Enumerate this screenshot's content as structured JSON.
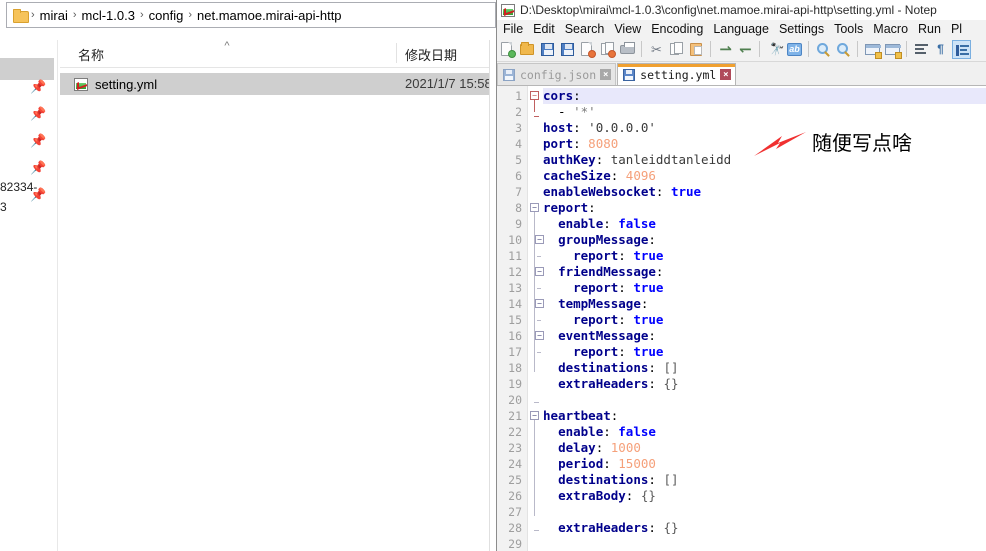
{
  "explorer": {
    "breadcrumb": {
      "folder_icon": "folder-icon",
      "items": [
        "mirai",
        "mcl-1.0.3",
        "config",
        "net.mamoe.mirai-api-http"
      ],
      "separator": "›"
    },
    "columns": {
      "name": "名称",
      "date_modified": "修改日期",
      "sort_caret": "^"
    },
    "files": [
      {
        "icon": "yml-file-icon",
        "name": "setting.yml",
        "date_modified": "2021/1/7 15:58"
      }
    ],
    "sidebar_fragments": {
      "pin_icon": "pin-icon",
      "pin_count": 5,
      "text_fragment_1": "82334-",
      "text_fragment_2": "3"
    }
  },
  "notepad": {
    "title": "D:\\Desktop\\mirai\\mcl-1.0.3\\config\\net.mamoe.mirai-api-http\\setting.yml - Notep",
    "title_icon": "npp-document-icon",
    "menu": [
      "File",
      "Edit",
      "Search",
      "View",
      "Encoding",
      "Language",
      "Settings",
      "Tools",
      "Macro",
      "Run",
      "Pl"
    ],
    "toolbar": [
      "new-file-icon",
      "open-file-icon",
      "save-icon",
      "save-all-icon",
      "close-file-icon",
      "close-all-icon",
      "print-icon",
      "sep",
      "cut-icon",
      "copy-icon",
      "paste-icon",
      "sep",
      "undo-icon",
      "redo-icon",
      "sep",
      "find-icon",
      "replace-icon",
      "sep",
      "zoom-in-icon",
      "zoom-out-icon",
      "sep",
      "sync-vertical-icon",
      "sync-horizontal-icon",
      "sep",
      "word-wrap-icon",
      "show-all-chars-icon",
      "indent-guide-icon"
    ],
    "tabs": [
      {
        "label": "config.json",
        "icon": "saved-doc-icon",
        "close": "×",
        "active": false
      },
      {
        "label": "setting.yml",
        "icon": "saved-doc-icon",
        "close": "×",
        "active": true
      }
    ],
    "editor": {
      "lines": [
        {
          "num": "1",
          "text": "cors:",
          "tokens": [
            {
              "t": "cors",
              "c": "k"
            },
            {
              "t": ":",
              "c": "p"
            }
          ]
        },
        {
          "num": "2",
          "text": "  - '*'",
          "tokens": [
            {
              "t": "  - ",
              "c": "p"
            },
            {
              "t": "'*'",
              "c": "s"
            }
          ]
        },
        {
          "num": "3",
          "text": "host: '0.0.0.0'",
          "tokens": [
            {
              "t": "host",
              "c": "k"
            },
            {
              "t": ": ",
              "c": "p"
            },
            {
              "t": "'0.0.0.0'",
              "c": "t"
            }
          ]
        },
        {
          "num": "4",
          "text": "port: 8080",
          "tokens": [
            {
              "t": "port",
              "c": "k"
            },
            {
              "t": ": ",
              "c": "p"
            },
            {
              "t": "8080",
              "c": "n"
            }
          ]
        },
        {
          "num": "5",
          "text": "authKey: tanleiddtanleidd",
          "tokens": [
            {
              "t": "authKey",
              "c": "k"
            },
            {
              "t": ": ",
              "c": "p"
            },
            {
              "t": "tanleiddtanleidd",
              "c": "t"
            }
          ]
        },
        {
          "num": "6",
          "text": "cacheSize: 4096",
          "tokens": [
            {
              "t": "cacheSize",
              "c": "k"
            },
            {
              "t": ": ",
              "c": "p"
            },
            {
              "t": "4096",
              "c": "n"
            }
          ]
        },
        {
          "num": "7",
          "text": "enableWebsocket: true",
          "tokens": [
            {
              "t": "enableWebsocket",
              "c": "k"
            },
            {
              "t": ": ",
              "c": "p"
            },
            {
              "t": "true",
              "c": "b"
            }
          ]
        },
        {
          "num": "8",
          "text": "report:",
          "tokens": [
            {
              "t": "report",
              "c": "k"
            },
            {
              "t": ":",
              "c": "p"
            }
          ]
        },
        {
          "num": "9",
          "text": "  enable: false",
          "tokens": [
            {
              "t": "  ",
              "c": "p"
            },
            {
              "t": "enable",
              "c": "k"
            },
            {
              "t": ": ",
              "c": "p"
            },
            {
              "t": "false",
              "c": "b"
            }
          ]
        },
        {
          "num": "10",
          "text": "  groupMessage:",
          "tokens": [
            {
              "t": "  ",
              "c": "p"
            },
            {
              "t": "groupMessage",
              "c": "k"
            },
            {
              "t": ":",
              "c": "p"
            }
          ]
        },
        {
          "num": "11",
          "text": "    report: true",
          "tokens": [
            {
              "t": "    ",
              "c": "p"
            },
            {
              "t": "report",
              "c": "k"
            },
            {
              "t": ": ",
              "c": "p"
            },
            {
              "t": "true",
              "c": "b"
            }
          ]
        },
        {
          "num": "12",
          "text": "  friendMessage:",
          "tokens": [
            {
              "t": "  ",
              "c": "p"
            },
            {
              "t": "friendMessage",
              "c": "k"
            },
            {
              "t": ":",
              "c": "p"
            }
          ]
        },
        {
          "num": "13",
          "text": "    report: true",
          "tokens": [
            {
              "t": "    ",
              "c": "p"
            },
            {
              "t": "report",
              "c": "k"
            },
            {
              "t": ": ",
              "c": "p"
            },
            {
              "t": "true",
              "c": "b"
            }
          ]
        },
        {
          "num": "14",
          "text": "  tempMessage:",
          "tokens": [
            {
              "t": "  ",
              "c": "p"
            },
            {
              "t": "tempMessage",
              "c": "k"
            },
            {
              "t": ":",
              "c": "p"
            }
          ]
        },
        {
          "num": "15",
          "text": "    report: true",
          "tokens": [
            {
              "t": "    ",
              "c": "p"
            },
            {
              "t": "report",
              "c": "k"
            },
            {
              "t": ": ",
              "c": "p"
            },
            {
              "t": "true",
              "c": "b"
            }
          ]
        },
        {
          "num": "16",
          "text": "  eventMessage:",
          "tokens": [
            {
              "t": "  ",
              "c": "p"
            },
            {
              "t": "eventMessage",
              "c": "k"
            },
            {
              "t": ":",
              "c": "p"
            }
          ]
        },
        {
          "num": "17",
          "text": "    report: true",
          "tokens": [
            {
              "t": "    ",
              "c": "p"
            },
            {
              "t": "report",
              "c": "k"
            },
            {
              "t": ": ",
              "c": "p"
            },
            {
              "t": "true",
              "c": "b"
            }
          ]
        },
        {
          "num": "18",
          "text": "  destinations: []",
          "tokens": [
            {
              "t": "  ",
              "c": "p"
            },
            {
              "t": "destinations",
              "c": "k"
            },
            {
              "t": ": ",
              "c": "p"
            },
            {
              "t": "[]",
              "c": "br"
            }
          ]
        },
        {
          "num": "19",
          "text": "  extraHeaders: {}",
          "tokens": [
            {
              "t": "  ",
              "c": "p"
            },
            {
              "t": "extraHeaders",
              "c": "k"
            },
            {
              "t": ": ",
              "c": "p"
            },
            {
              "t": "{}",
              "c": "br"
            }
          ]
        },
        {
          "num": "20",
          "text": "",
          "tokens": []
        },
        {
          "num": "21",
          "text": "heartbeat:",
          "tokens": [
            {
              "t": "heartbeat",
              "c": "k"
            },
            {
              "t": ":",
              "c": "p"
            }
          ]
        },
        {
          "num": "22",
          "text": "  enable: false",
          "tokens": [
            {
              "t": "  ",
              "c": "p"
            },
            {
              "t": "enable",
              "c": "k"
            },
            {
              "t": ": ",
              "c": "p"
            },
            {
              "t": "false",
              "c": "b"
            }
          ]
        },
        {
          "num": "23",
          "text": "  delay: 1000",
          "tokens": [
            {
              "t": "  ",
              "c": "p"
            },
            {
              "t": "delay",
              "c": "k"
            },
            {
              "t": ": ",
              "c": "p"
            },
            {
              "t": "1000",
              "c": "n"
            }
          ]
        },
        {
          "num": "24",
          "text": "  period: 15000",
          "tokens": [
            {
              "t": "  ",
              "c": "p"
            },
            {
              "t": "period",
              "c": "k"
            },
            {
              "t": ": ",
              "c": "p"
            },
            {
              "t": "15000",
              "c": "n"
            }
          ]
        },
        {
          "num": "25",
          "text": "  destinations: []",
          "tokens": [
            {
              "t": "  ",
              "c": "p"
            },
            {
              "t": "destinations",
              "c": "k"
            },
            {
              "t": ": ",
              "c": "p"
            },
            {
              "t": "[]",
              "c": "br"
            }
          ]
        },
        {
          "num": "26",
          "text": "  extraBody: {}",
          "tokens": [
            {
              "t": "  ",
              "c": "p"
            },
            {
              "t": "extraBody",
              "c": "k"
            },
            {
              "t": ": ",
              "c": "p"
            },
            {
              "t": "{}",
              "c": "br"
            }
          ]
        },
        {
          "num": "27",
          "text": "",
          "tokens": []
        },
        {
          "num": "28",
          "text": "  extraHeaders: {}",
          "tokens": [
            {
              "t": "  ",
              "c": "p"
            },
            {
              "t": "extraHeaders",
              "c": "k"
            },
            {
              "t": ": ",
              "c": "p"
            },
            {
              "t": "{}",
              "c": "br"
            }
          ]
        },
        {
          "num": "29",
          "text": "",
          "tokens": []
        }
      ],
      "current_line": 1,
      "colors": {
        "key": "#00008b",
        "number": "#f5a07a",
        "boolean": "#0000ff",
        "current_line_highlight": "#e8e8fb",
        "gutter_bg": "#f2f2f2",
        "line_number": "#9e9e9e"
      }
    }
  },
  "annotation": {
    "text": "随便写点啥",
    "arrow_icon": "red-arrow-icon",
    "arrow_color": "#f03030"
  }
}
